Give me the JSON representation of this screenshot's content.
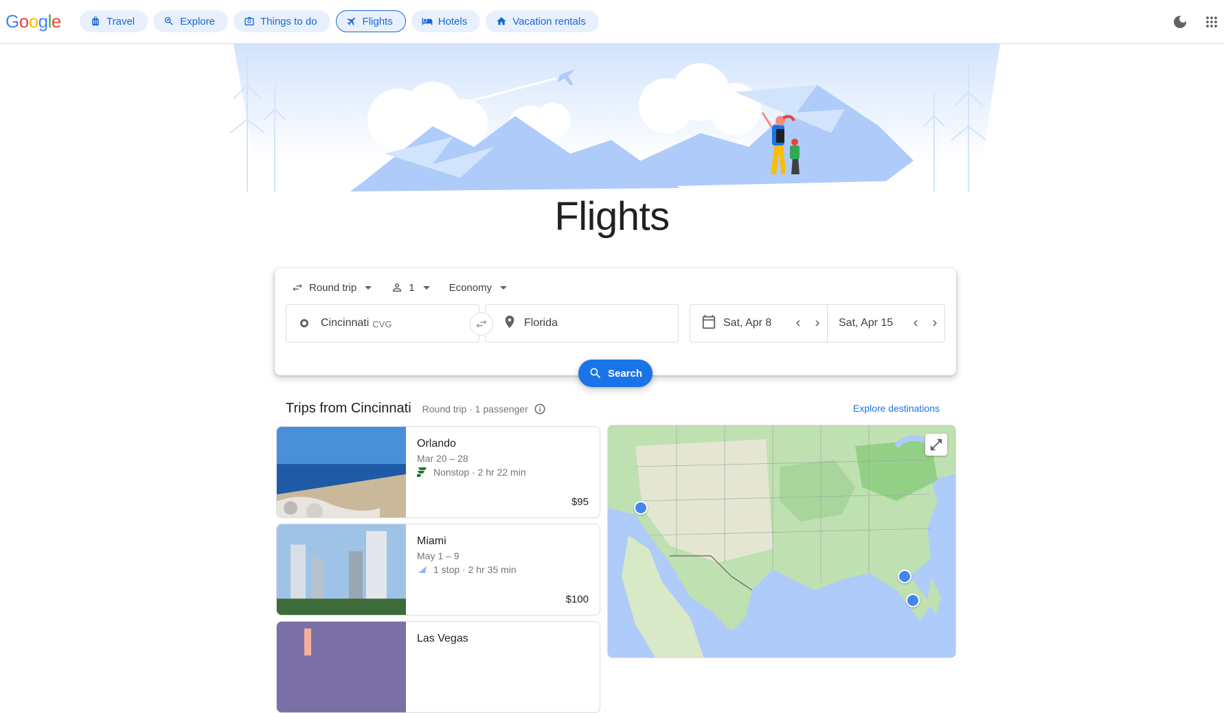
{
  "header": {
    "logo": [
      "G",
      "o",
      "o",
      "g",
      "l",
      "e"
    ],
    "logo_colors": [
      "#4285f4",
      "#ea4335",
      "#fbbc05",
      "#4285f4",
      "#34a853",
      "#ea4335"
    ],
    "nav": [
      {
        "label": "Travel",
        "icon": "suitcase-icon"
      },
      {
        "label": "Explore",
        "icon": "explore-icon"
      },
      {
        "label": "Things to do",
        "icon": "camera-icon"
      },
      {
        "label": "Flights",
        "icon": "airplane-icon",
        "active": true
      },
      {
        "label": "Hotels",
        "icon": "bed-icon"
      },
      {
        "label": "Vacation rentals",
        "icon": "house-icon"
      }
    ],
    "accent": "#1967d2"
  },
  "hero": {
    "title": "Flights"
  },
  "search": {
    "trip_type": "Round trip",
    "passengers": "1",
    "cabin": "Economy",
    "from_city": "Cincinnati",
    "from_code": "CVG",
    "to": "Florida",
    "depart": "Sat, Apr 8",
    "return": "Sat, Apr 15",
    "button_label": "Search",
    "button_color": "#1a73e8"
  },
  "trips": {
    "title": "Trips from Cincinnati",
    "subtitle": "Round trip · 1 passenger",
    "explore_link": "Explore destinations",
    "items": [
      {
        "city": "Orlando",
        "dates": "Mar 20 – 28",
        "stops": "Nonstop · 2 hr 22 min",
        "price": "$95"
      },
      {
        "city": "Miami",
        "dates": "May 1 – 9",
        "stops": "1 stop · 2 hr 35 min",
        "price": "$100"
      },
      {
        "city": "Las Vegas",
        "dates": "",
        "stops": "",
        "price": ""
      }
    ]
  }
}
